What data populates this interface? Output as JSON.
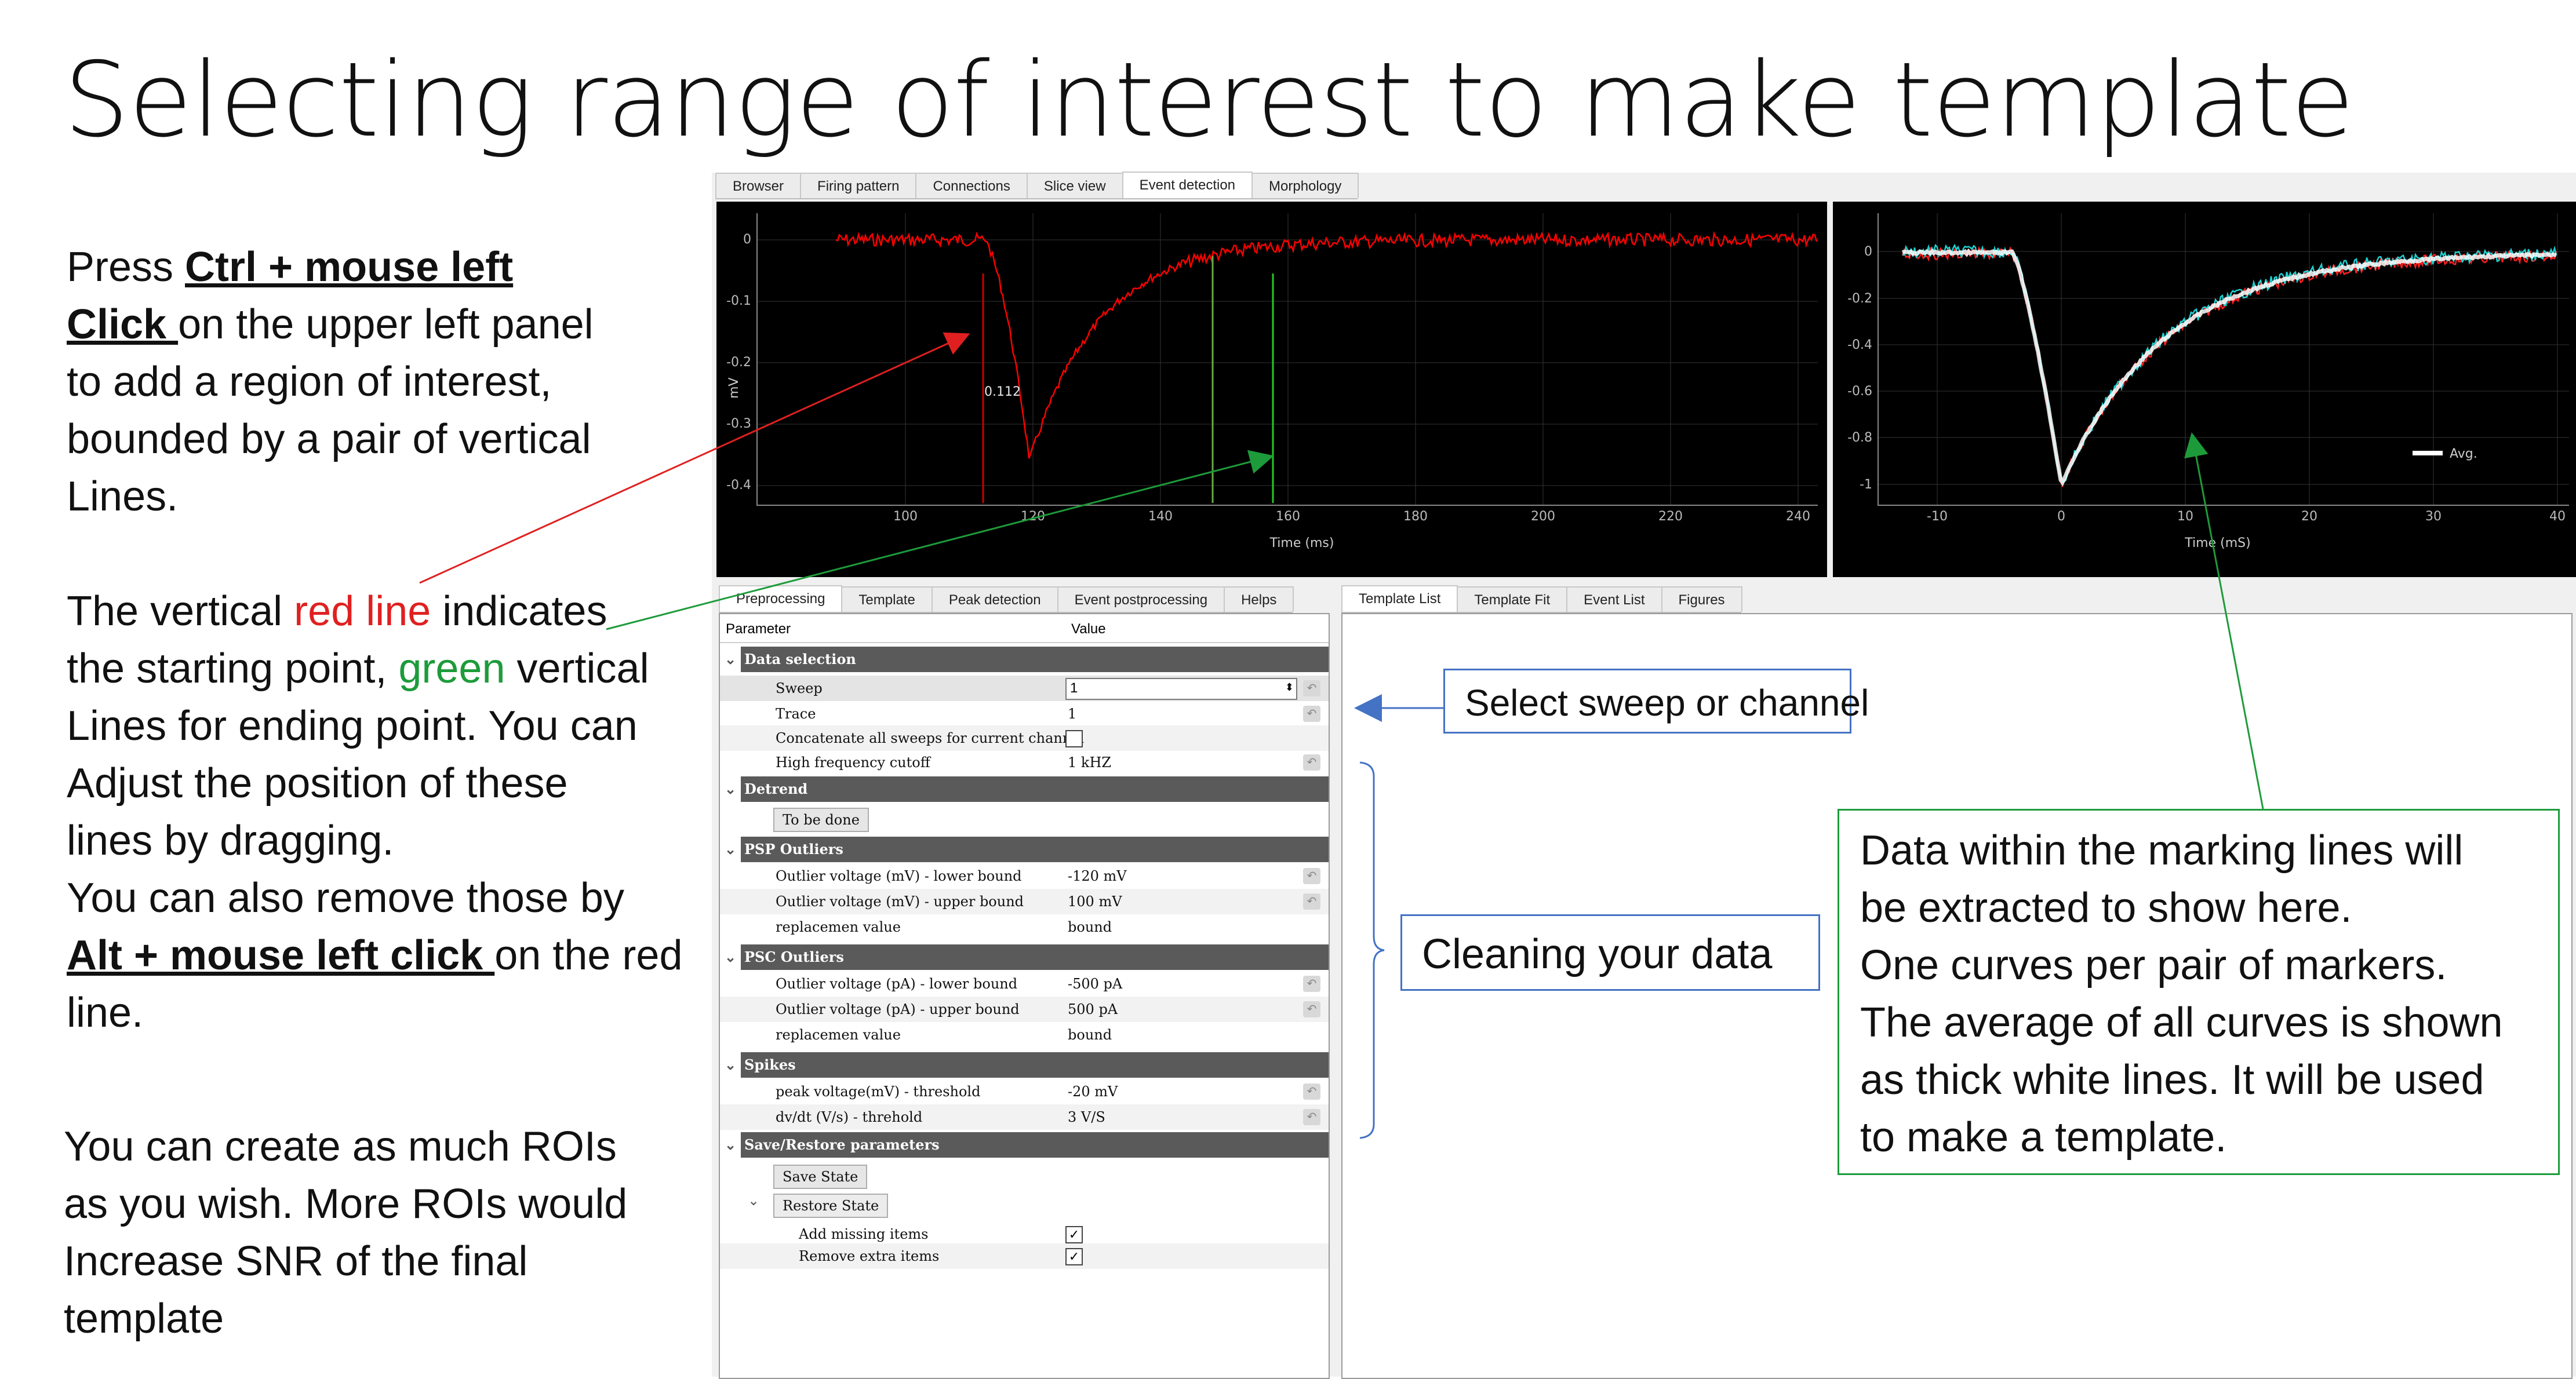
{
  "slide": {
    "title": "Selecting range of interest to make template",
    "para1": {
      "press": "Press ",
      "ctrl": "Ctrl + mouse left",
      "click": "Click ",
      "rest1": "on the upper left panel",
      "line3": "to add a region of interest,",
      "line4": "bounded by a pair of vertical",
      "line5": "Lines."
    },
    "para2": {
      "a": "The vertical ",
      "red": "red line",
      "b": " indicates",
      "c": "the starting point, ",
      "green": "green",
      "d": " vertical",
      "e": "Lines for ending point. You can",
      "f": "Adjust the position of these",
      "g": "lines by dragging.",
      "h": "You can also remove those by",
      "alt": "Alt + mouse left click ",
      "i": "on the red",
      "j": "line."
    },
    "para3": {
      "a": "You can create as much ROIs",
      "b": "as you wish. More ROIs would",
      "c": "Increase SNR of the final",
      "d": "template"
    },
    "callouts": {
      "sweep": "Select sweep or channel",
      "clean": "Cleaning  your data",
      "data": [
        "Data within the marking lines will",
        "be extracted to show here.",
        "One curves per pair of markers.",
        "The average of all curves is shown",
        "as thick white lines.  It will be used",
        "to make a template."
      ]
    }
  },
  "app": {
    "top_tabs": [
      "Browser",
      "Firing pattern",
      "Connections",
      "Slice view",
      "Event detection",
      "Morphology"
    ],
    "top_tab_active": "Event detection",
    "left_tabs": [
      "Preprocessing",
      "Template",
      "Peak detection",
      "Event postprocessing",
      "Helps"
    ],
    "left_tab_active": "Preprocessing",
    "right_tabs": [
      "Template List",
      "Template Fit",
      "Event List",
      "Figures"
    ],
    "right_tab_active": "Template List",
    "plot_left": {
      "ylabel": "mV",
      "xlabel": "Time (ms)",
      "yticks": [
        "0",
        "-0.1",
        "-0.2",
        "-0.3",
        "-0.4"
      ],
      "xticks": [
        "100",
        "120",
        "140",
        "160",
        "180",
        "200",
        "220",
        "240"
      ],
      "roi_label": "0.112",
      "trace_color": "#ff0000",
      "start_line_color": "#cc0000",
      "end_line_color": "#22cc22"
    },
    "plot_right": {
      "xlabel": "Time (mS)",
      "yticks": [
        "0",
        "-0.2",
        "-0.4",
        "-0.6",
        "-0.8",
        "-1"
      ],
      "xticks": [
        "-10",
        "0",
        "10",
        "20",
        "30",
        "40"
      ],
      "legend": "Avg.",
      "curve_colors": [
        "#ff2020",
        "#20d0d0",
        "#ffffff"
      ]
    },
    "tree": {
      "header_param": "Parameter",
      "header_value": "Value",
      "groups": {
        "data_selection": "Data selection",
        "detrend": "Detrend",
        "psp": "PSP Outliers",
        "psc": "PSC Outliers",
        "spikes": "Spikes",
        "save_restore": "Save/Restore parameters"
      },
      "sweep": {
        "label": "Sweep",
        "value": "1"
      },
      "trace": {
        "label": "Trace",
        "value": "1"
      },
      "concat": {
        "label": "Concatenate all sweeps for current channel"
      },
      "hfc": {
        "label": "High frequency cutoff",
        "value": "1 kHZ"
      },
      "detrend_btn": "To be done",
      "psp_lower": {
        "label": "Outlier voltage (mV) - lower bound",
        "value": "-120 mV"
      },
      "psp_upper": {
        "label": "Outlier voltage (mV) - upper bound",
        "value": "100 mV"
      },
      "psp_replace": {
        "label": "replacemen value",
        "value": "bound"
      },
      "psc_lower": {
        "label": "Outlier voltage (pA) - lower bound",
        "value": "-500 pA"
      },
      "psc_upper": {
        "label": "Outlier voltage (pA) - upper bound",
        "value": "500 pA"
      },
      "psc_replace": {
        "label": "replacemen value",
        "value": "bound"
      },
      "peak_thr": {
        "label": "peak voltage(mV) - threshold",
        "value": "-20 mV"
      },
      "dvdt_thr": {
        "label": "dv/dt (V/s) - threhold",
        "value": "3 V/S"
      },
      "save_btn": "Save State",
      "restore_btn": "Restore State",
      "add_missing": {
        "label": "Add missing items"
      },
      "remove_extra": {
        "label": "Remove extra items"
      }
    }
  }
}
